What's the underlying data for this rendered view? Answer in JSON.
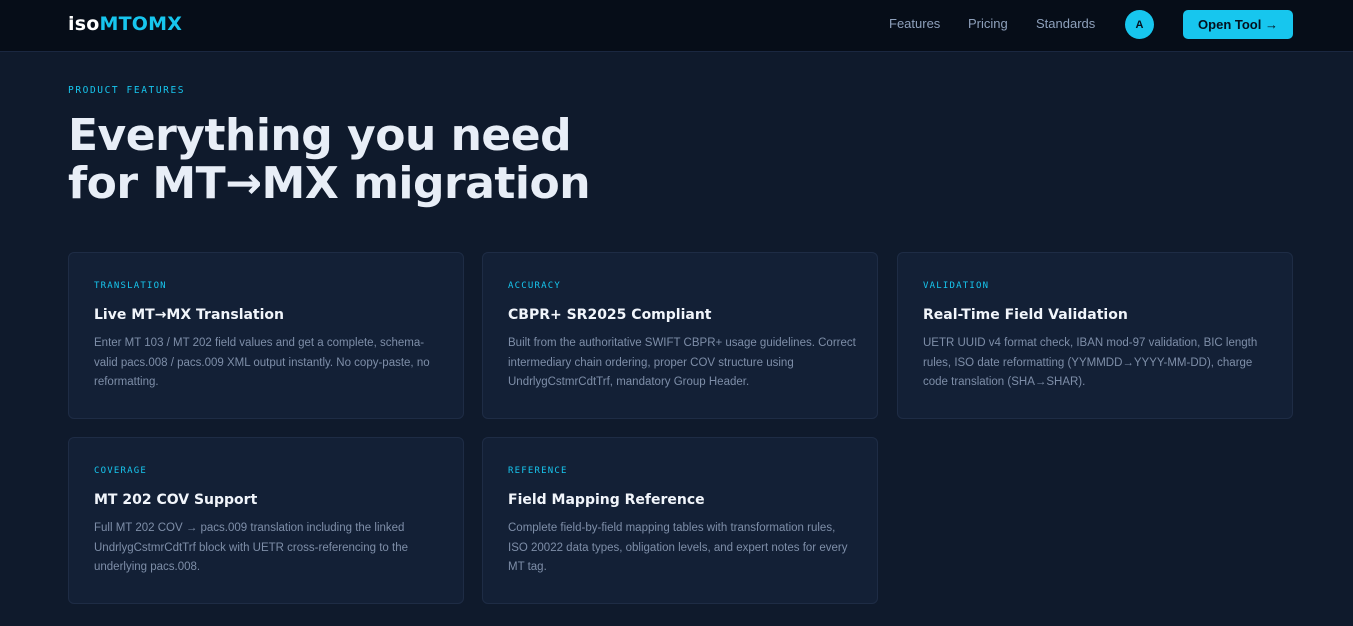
{
  "header": {
    "logo_prefix": "iso",
    "logo_suffix": "MTOMX",
    "nav": [
      "Features",
      "Pricing",
      "Standards"
    ],
    "avatar_initial": "A",
    "cta_label": "Open Tool →"
  },
  "hero": {
    "eyebrow": "PRODUCT FEATURES",
    "headline_line1": "Everything you need",
    "headline_line2": "for MT→MX migration"
  },
  "cards": [
    {
      "tag": "TRANSLATION",
      "title": "Live MT→MX Translation",
      "body": "Enter MT 103 / MT 202 field values and get a complete, schema-valid pacs.008 / pacs.009 XML output instantly. No copy-paste, no reformatting."
    },
    {
      "tag": "ACCURACY",
      "title": "CBPR+ SR2025 Compliant",
      "body": "Built from the authoritative SWIFT CBPR+ usage guidelines. Correct intermediary chain ordering, proper COV structure using UndrlygCstmrCdtTrf, mandatory Group Header."
    },
    {
      "tag": "VALIDATION",
      "title": "Real-Time Field Validation",
      "body": "UETR UUID v4 format check, IBAN mod-97 validation, BIC length rules, ISO date reformatting (YYMMDD→YYYY-MM-DD), charge code translation (SHA→SHAR)."
    },
    {
      "tag": "COVERAGE",
      "title": "MT 202 COV Support",
      "body": "Full MT 202 COV → pacs.009 translation including the linked UndrlygCstmrCdtTrf block with UETR cross-referencing to the underlying pacs.008."
    },
    {
      "tag": "REFERENCE",
      "title": "Field Mapping Reference",
      "body": "Complete field-by-field mapping tables with transformation rules, ISO 20022 data types, obligation levels, and expert notes for every MT tag."
    }
  ],
  "colors": {
    "accent": "#17c6ee",
    "background": "#0f1a2c",
    "card": "#132036",
    "topbar": "#060d18"
  }
}
